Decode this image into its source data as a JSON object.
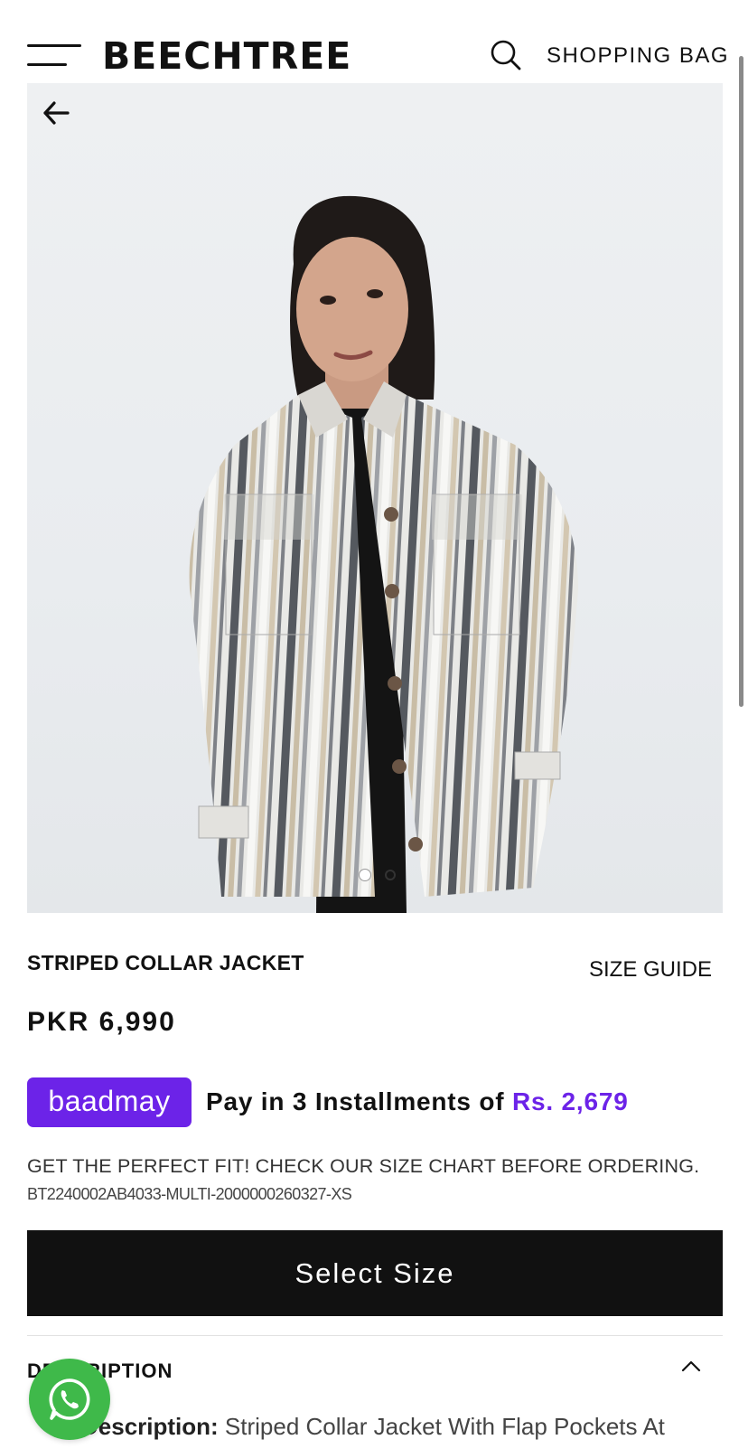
{
  "header": {
    "brand": "BEECHTREE",
    "menu_icon": "hamburger-menu-icon",
    "search_icon": "search-icon",
    "bag_label": "SHOPPING BAG"
  },
  "gallery": {
    "back_icon": "arrow-left-icon",
    "current_slide": 1,
    "total_slides": 2,
    "image_alt": "Woman wearing striped collar jacket"
  },
  "product": {
    "title": "STRIPED COLLAR JACKET",
    "size_guide_label": "SIZE GUIDE",
    "price": "PKR 6,990"
  },
  "installments": {
    "provider": "baadmay",
    "text": "Pay in 3 Installments of ",
    "amount": "Rs. 2,679",
    "accent_color": "#6c23e8"
  },
  "fit_note": "GET THE PERFECT FIT! CHECK OUR SIZE CHART BEFORE ORDERING.",
  "sku": "BT2240002AB4033-MULTI-2000000260327-XS",
  "select_size_label": "Select Size",
  "description": {
    "heading": "DESCRIPTION",
    "label": "Description:",
    "text": " Striped Collar Jacket With Flap Pockets At Front, Straight Hem Along With Box Pleat At Back"
  },
  "whatsapp_icon": "whatsapp-icon",
  "colors": {
    "button_bg": "#111111",
    "whatsapp_green": "#3fb94a"
  }
}
